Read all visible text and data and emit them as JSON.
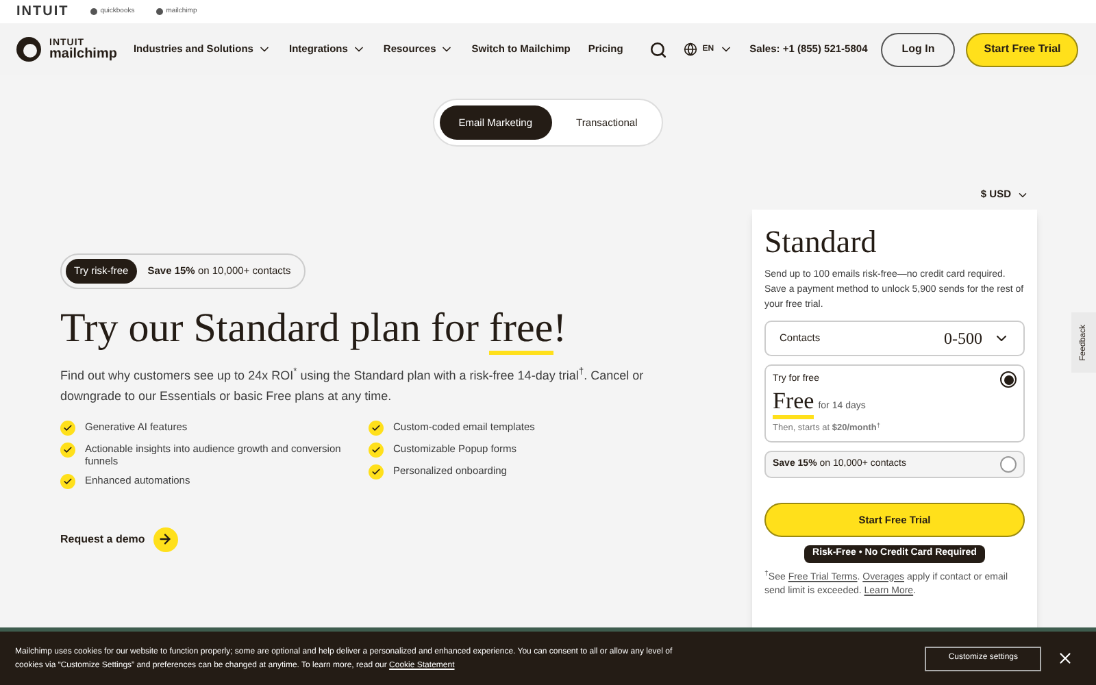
{
  "brand_bar": {
    "items": [
      {
        "kind": "intuit",
        "label": "INTUIT"
      },
      {
        "kind": "sub",
        "label": "quickbooks"
      },
      {
        "kind": "sub",
        "label": "mailchimp"
      }
    ]
  },
  "nav": {
    "logo_top": "INTUIT",
    "logo_bottom": "mailchimp",
    "items": [
      {
        "label": "Industries and Solutions",
        "dropdown": true
      },
      {
        "label": "Integrations",
        "dropdown": true
      },
      {
        "label": "Resources",
        "dropdown": true
      },
      {
        "label": "Switch to Mailchimp",
        "dropdown": false
      },
      {
        "label": "Pricing",
        "dropdown": false
      }
    ],
    "language": "EN",
    "sales": "Sales: +1 (855) 521-5804",
    "login": "Log In",
    "cta": "Start Free Trial"
  },
  "product_tabs": [
    {
      "label": "Email Marketing",
      "selected": true
    },
    {
      "label": "Transactional",
      "selected": false
    }
  ],
  "currency": "$ USD",
  "hero": {
    "pill_badge": "Try risk-free",
    "pill_text": "**Save 15%** on 10,000+ contacts",
    "headline_before": "Try our Standard plan for ",
    "headline_highlight": "free",
    "headline_after": "!",
    "body": "Find out why customers see up to 24x ROI$^{*}$ using the Standard plan with a risk-free 14-day trial$^{†}$. Cancel or downgrade to our Essentials or basic Free plans at any time.",
    "features": [
      [
        "Generative AI features",
        "Actionable insights into audience growth and conversion funnels",
        "Enhanced automations"
      ],
      [
        "Custom-coded email templates",
        "Customizable Popup forms",
        "Personalized onboarding"
      ]
    ],
    "demo": "Request a demo"
  },
  "plan_card": {
    "title": "Standard",
    "description": "Send up to 100 emails risk-free—no credit card required. Save a payment method to unlock 5,900 sends for the rest of your free trial.",
    "contacts_label": "Contacts",
    "contacts_value": "0-500",
    "options": [
      {
        "kind": "trial",
        "label": "Try for free",
        "price": "Free",
        "period": "for 14 days",
        "note": "Then, starts at **$20/month**$^{†}$",
        "selected": true
      },
      {
        "kind": "discount",
        "label": "**Save 15%** on 10,000+ contacts",
        "selected": false
      }
    ],
    "cta": "Start Free Trial",
    "badge": "Risk-Free • No Credit Card Required",
    "footnote": [
      {
        "text": "$^{†}$See ",
        "link": false
      },
      {
        "text": "Free Trial Terms",
        "link": true
      },
      {
        "text": ". ",
        "link": false
      },
      {
        "text": "Overages",
        "link": true
      },
      {
        "text": " apply if contact or email send limit is exceeded. ",
        "link": false
      },
      {
        "text": "Learn More",
        "link": true
      },
      {
        "text": ".",
        "link": false
      }
    ]
  },
  "feedback": "Feedback",
  "cookie_banner": {
    "segments": [
      {
        "text": "Mailchimp uses cookies for our website to function properly; some are optional and help deliver a personalized and enhanced experience. You can consent to all or allow any level of cookies via “Customize Settings” and preferences can be changed at anytime. To learn more, read our ",
        "link": false
      },
      {
        "text": "Cookie Statement",
        "link": true
      }
    ],
    "button": "Customize settings"
  }
}
